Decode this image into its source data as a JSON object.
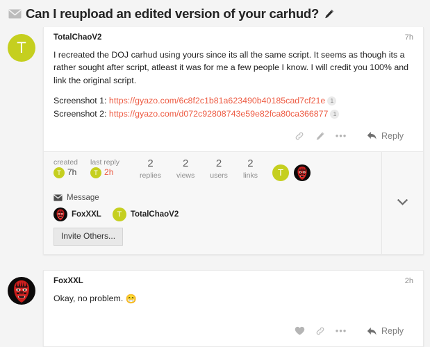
{
  "topic": {
    "envelope_icon": "envelope-icon",
    "title": "Can I reupload an edited version of your carhud?",
    "edit_icon": "pencil-icon"
  },
  "colors": {
    "page_bg": "#f4f4f4",
    "card_bg": "#ffffff",
    "link": "#ed5b43",
    "avatar_letter_bg": "#c5cf1f",
    "muted_text": "#919191",
    "topic_map_bg": "#f7f7f7"
  },
  "posts": [
    {
      "avatar": {
        "type": "letter",
        "letter": "T",
        "name": "avatar-totalchaov2"
      },
      "username": "TotalChaoV2",
      "time": "7h",
      "paragraphs": [
        "I recreated the DOJ carhud using yours since its all the same script. It seems as though its a rather sought after script, atleast it was for me a few people I know. I will credit you 100% and link the original script."
      ],
      "screenshots": [
        {
          "label": "Screenshot 1:",
          "url": "https://gyazo.com/6c8f2c1b81a623490b40185cad7cf21e",
          "badge": "1"
        },
        {
          "label": "Screenshot 2:",
          "url": "https://gyazo.com/d072c92808743e59e82fca80ca366877",
          "badge": "1"
        }
      ],
      "actions": {
        "like": null,
        "link_label": "link-icon",
        "edit_label": "pencil-icon",
        "more_label": "ellipsis-icon",
        "reply_label": "Reply"
      }
    },
    {
      "avatar": {
        "type": "image",
        "letter": "",
        "name": "avatar-foxxxl"
      },
      "username": "FoxXXL",
      "time": "2h",
      "paragraphs": [
        "Okay, no problem."
      ],
      "emoji": "😁",
      "screenshots": [],
      "actions": {
        "like": "heart-icon",
        "link_label": "link-icon",
        "more_label": "ellipsis-icon",
        "reply_label": "Reply"
      }
    }
  ],
  "topic_map": {
    "created": {
      "label": "created",
      "value": "7h",
      "avatar_letter": "T"
    },
    "last_reply": {
      "label": "last reply",
      "value": "2h",
      "avatar_letter": "T"
    },
    "stats": [
      {
        "count": "2",
        "label": "replies"
      },
      {
        "count": "2",
        "label": "views"
      },
      {
        "count": "2",
        "label": "users"
      },
      {
        "count": "2",
        "label": "links"
      }
    ],
    "avatars": [
      {
        "type": "letter",
        "letter": "T"
      },
      {
        "type": "image",
        "letter": ""
      }
    ],
    "expand_icon": "chevron-down-icon"
  },
  "message_section": {
    "heading": "Message",
    "envelope_icon": "envelope-icon",
    "participants": [
      {
        "name": "FoxXXL",
        "avatar_type": "image",
        "letter": ""
      },
      {
        "name": "TotalChaoV2",
        "avatar_type": "letter",
        "letter": "T"
      }
    ],
    "invite_button": "Invite Others..."
  }
}
